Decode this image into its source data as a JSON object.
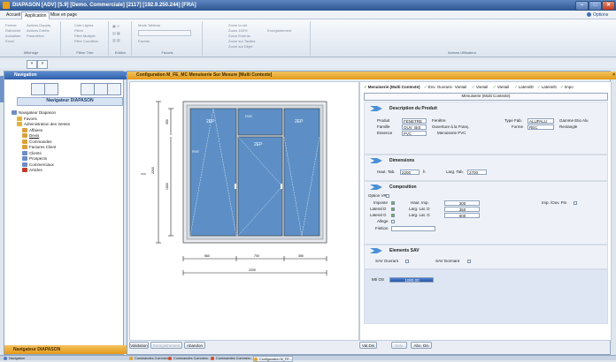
{
  "window": {
    "title": "DIAPASON  [ADV] [5.9] [Demo. Commerciale] [2117] [192.9.250.244] [FRA]",
    "minimize_glyph": "–",
    "maximize_glyph": "□",
    "close_glyph": "✕",
    "options_label": "Options"
  },
  "menu": {
    "items": [
      "Accueil",
      "Application",
      "Mise en page"
    ],
    "active_index": 1
  },
  "ribbon": {
    "groups": [
      {
        "label": "Affichage",
        "lines": [
          "Fermer",
          "Actions Duppiq",
          "Rafraîchir",
          "Actions Entête",
          "Actualiser",
          "Paramétrer",
          "Excel"
        ]
      },
      {
        "label": "Filtrer Trier",
        "lines": [
          "Cote Lignes",
          "Filtrer",
          "Filtre Multiple",
          "Filtre Condition"
        ]
      },
      {
        "label": "Edition",
        "lines": [
          "Mode Tableau"
        ]
      },
      {
        "label": "Favoris",
        "lines": [
          "Favoris"
        ]
      },
      {
        "label": "",
        "lines": [
          "Zoom to set",
          "Zoom 100%",
          "Zoom Extents",
          "Enregistrement",
          "Zoom sur Tacites",
          "Zoom sur Dbjet"
        ]
      },
      {
        "label": "Actions Utilisateur",
        "lines": []
      }
    ]
  },
  "nav_panel": {
    "title": "Navigation",
    "subtitle": "Navigateur DIAPASON",
    "footer": "Navigateur DIAPASON",
    "tree": [
      {
        "label": "Navigateur Diapason",
        "level": 0,
        "color": "#6f8fc2"
      },
      {
        "label": "Favoris",
        "level": 1,
        "color": "#e2b23a"
      },
      {
        "label": "Administration des Ventes",
        "level": 1,
        "color": "#e2b23a"
      },
      {
        "label": "Affaires",
        "level": 2,
        "color": "#d9a13b"
      },
      {
        "label": "Devis",
        "level": 2,
        "color": "#d9a13b"
      },
      {
        "label": "Commandes",
        "level": 2,
        "color": "#d9a13b"
      },
      {
        "label": "Factures Client",
        "level": 2,
        "color": "#d9a13b"
      },
      {
        "label": "Clients",
        "level": 2,
        "color": "#6d8cc4"
      },
      {
        "label": "Prospects",
        "level": 2,
        "color": "#6d8cc4"
      },
      {
        "label": "Commerciaux",
        "level": 2,
        "color": "#6d8cc4"
      },
      {
        "label": "Articles",
        "level": 2,
        "color": "#c23a2a"
      }
    ]
  },
  "config_window": {
    "title": "Configuration M_FE_MC Menuiserie Sur Mesure [Multi Contexte]",
    "close_glyph": "×",
    "tabs": [
      "Menuiserie (Multi Contexte)",
      "Env. Ouvrant",
      "Vantail",
      "Vantail",
      "Vantail",
      "LateralD",
      "LateralG",
      "Impo"
    ],
    "subbar": "Menuiserie (Multi Contexte)",
    "drawing": {
      "dims": [
        "1600",
        "1530",
        "2200",
        "700",
        "1400",
        "560",
        "1000",
        "350",
        "20"
      ],
      "panel_labels": [
        "2EP",
        "2EP",
        "2EP",
        "FIXE",
        "FIXE"
      ]
    },
    "product": {
      "section_title": "Description du Produit",
      "produit_label": "Produit",
      "produit_value": "FENETRE",
      "fenetre_label": "Fenêtre",
      "famille_label": "Famille",
      "famille_value": "OUV_BIS",
      "ouverture_label": "Ouverture à la Franç.",
      "essence_label": "Essence",
      "essence_value": "PVC",
      "menuiserie_label": "Menuiserie PVC",
      "typefab_label": "Type Fab.",
      "typefab_value": "ALUPALU",
      "gamme_label": "Gamme Etio Alu",
      "forme_label": "Forme",
      "forme_value": "REC",
      "rectangle_label": "Rectangle"
    },
    "dimensions": {
      "section_title": "Dimensions",
      "haut_label": "Haut. Tab.",
      "haut_value": "2200",
      "haut_unit": "h",
      "larg_label": "Larg. Tab.",
      "larg_value": "2700"
    },
    "composition": {
      "section_title": "Composition",
      "option_label": "Option VR",
      "imposte_label": "Imposte",
      "haut_imp_label": "Haut. Imp.",
      "haut_imp_value": "300",
      "imp_ouv_label": "Imp. /Ouv. Pm",
      "lateral_d_label": "Lateral D",
      "larg_lat_d_label": "Larg. Lat. D",
      "larg_lat_d_value": "350",
      "lateral_g_label": "Lateral G",
      "larg_lat_g_label": "Larg. Lat. G",
      "larg_lat_g_value": "600",
      "allege_label": "Allege",
      "finition_label": "Finition"
    },
    "sav": {
      "section_title": "Elements SAV",
      "sav_ouvrant_label": "SAV Ouvrant",
      "sav_dormant_label": "SAV Dormant"
    },
    "price": {
      "label": "Mt/ OS",
      "value": "1080,00"
    },
    "left_buttons": [
      "Validation",
      "Enregistrement",
      "Abandon"
    ],
    "right_buttons": [
      "Val.Dis",
      "Suiv.",
      "Abo. Dis"
    ]
  },
  "taskbar": {
    "items": [
      "Navigation",
      "Commandes Commerc...",
      "Commandes Commerc...",
      "Commandes Commerc...",
      "Configuration M_FE..."
    ]
  },
  "colors": {
    "accent": "#e39a18",
    "title_blue": "#2c568f",
    "glass": "#5d8fc6"
  }
}
